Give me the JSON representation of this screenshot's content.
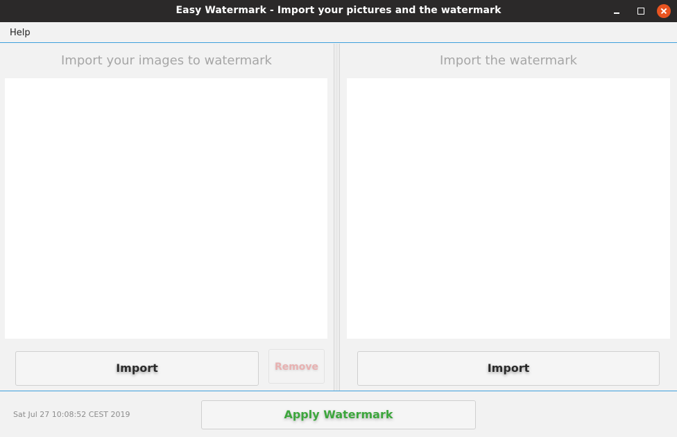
{
  "window": {
    "title": "Easy Watermark - Import your pictures and the watermark",
    "controls": [
      "minimize-icon",
      "maximize-icon",
      "close-icon"
    ],
    "close_color": "#e95420"
  },
  "menu": {
    "items": [
      "Help"
    ]
  },
  "images_panel": {
    "title": "Import your images to watermark",
    "import_label": "Import",
    "remove_label": "Remove",
    "remove_enabled": false
  },
  "watermark_panel": {
    "title": "Import the watermark",
    "import_label": "Import"
  },
  "footer": {
    "status": "Sat Jul 27 10:08:52 CEST 2019",
    "apply_label": "Apply Watermark",
    "apply_color": "#3ca63c"
  },
  "accent_color": "#3c9fdc"
}
